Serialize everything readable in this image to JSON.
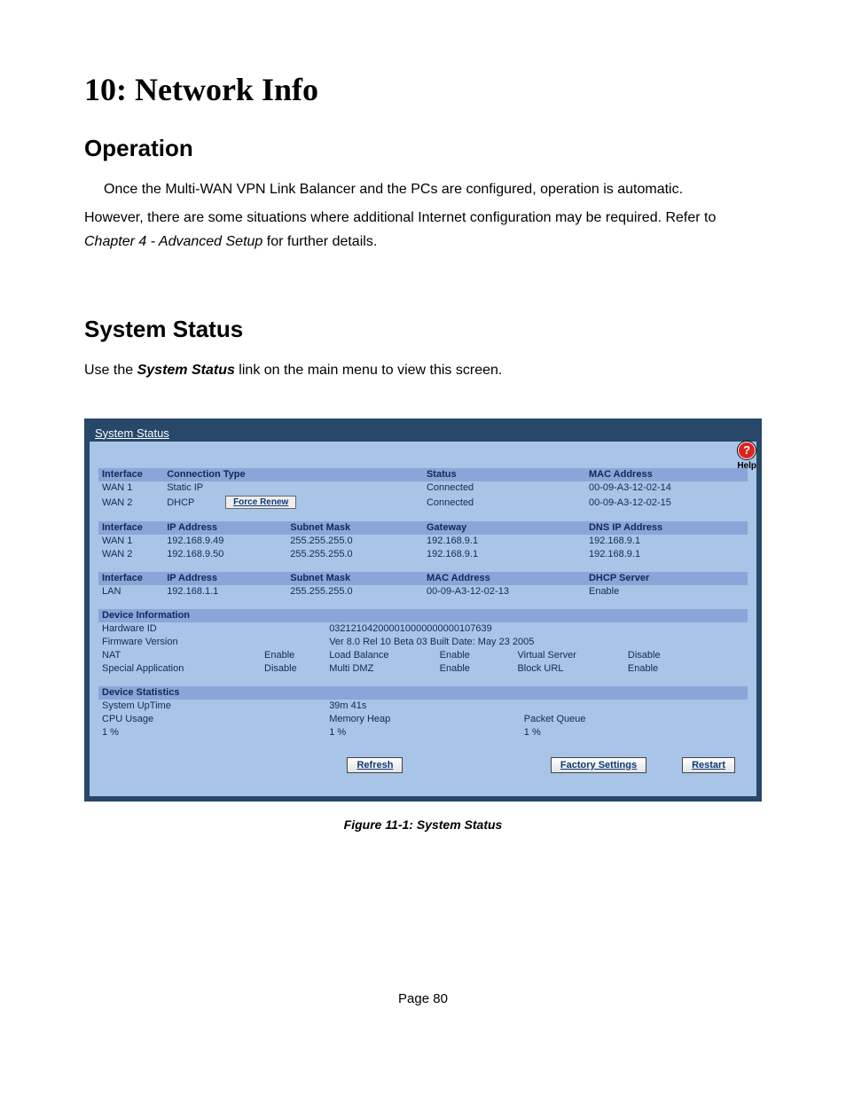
{
  "chapter_title": "10: Network Info",
  "section_operation": "Operation",
  "para_op_1": "Once the Multi-WAN VPN Link Balancer and the PCs are configured, operation is automatic.",
  "para_op_2a": "However, there are some situations where additional Internet configuration may be required. Refer to ",
  "para_op_2b": "Chapter 4 - Advanced Setup",
  "para_op_2c": " for further details.",
  "section_status": "System Status",
  "para_status_a": "Use the ",
  "para_status_b": "System Status",
  "para_status_c": " link on the main menu to view this screen.",
  "panel": {
    "title": "System Status",
    "help_label": "Help",
    "table1": {
      "headers": {
        "c1": "Interface",
        "c2": "Connection Type",
        "c3": "Status",
        "c4": "MAC Address"
      },
      "rows": [
        {
          "c1": "WAN 1",
          "c2": "Static IP",
          "btn": "",
          "c3": "Connected",
          "c4": "00-09-A3-12-02-14"
        },
        {
          "c1": "WAN 2",
          "c2": "DHCP",
          "btn": "Force Renew",
          "c3": "Connected",
          "c4": "00-09-A3-12-02-15"
        }
      ]
    },
    "table2": {
      "headers": {
        "c1": "Interface",
        "c2": "IP Address",
        "c3": "Subnet Mask",
        "c4": "Gateway",
        "c5": "DNS IP Address"
      },
      "rows": [
        {
          "c1": "WAN 1",
          "c2": "192.168.9.49",
          "c3": "255.255.255.0",
          "c4": "192.168.9.1",
          "c5": "192.168.9.1"
        },
        {
          "c1": "WAN 2",
          "c2": "192.168.9.50",
          "c3": "255.255.255.0",
          "c4": "192.168.9.1",
          "c5": "192.168.9.1"
        }
      ]
    },
    "table3": {
      "headers": {
        "c1": "Interface",
        "c2": "IP Address",
        "c3": "Subnet Mask",
        "c4": "MAC Address",
        "c5": "DHCP Server"
      },
      "rows": [
        {
          "c1": "LAN",
          "c2": "192.168.1.1",
          "c3": "255.255.255.0",
          "c4": "00-09-A3-12-02-13",
          "c5": "Enable"
        }
      ]
    },
    "devinfo": {
      "title": "Device Information",
      "hardware_id_label": "Hardware ID",
      "hardware_id": "032121042000010000000000107639",
      "firmware_label": "Firmware Version",
      "firmware": "Ver 8.0 Rel 10 Beta 03 Built Date: May 23 2005",
      "row3": {
        "l1": "NAT",
        "v1": "Enable",
        "l2": "Load Balance",
        "v2": "Enable",
        "l3": "Virtual Server",
        "v3": "Disable"
      },
      "row4": {
        "l1": "Special Application",
        "v1": "Disable",
        "l2": "Multi DMZ",
        "v2": "Enable",
        "l3": "Block URL",
        "v3": "Enable"
      }
    },
    "devstats": {
      "title": "Device Statistics",
      "uptime_label": "System UpTime",
      "uptime": "39m 41s",
      "cpu_label": "CPU Usage",
      "mem_label": "Memory Heap",
      "pq_label": "Packet Queue",
      "cpu": "1 %",
      "mem": "1 %",
      "pq": "1 %"
    },
    "buttons": {
      "refresh": "Refresh",
      "factory": "Factory Settings",
      "restart": "Restart"
    }
  },
  "figure_caption": "Figure 11-1: System Status",
  "page_number": "Page 80"
}
